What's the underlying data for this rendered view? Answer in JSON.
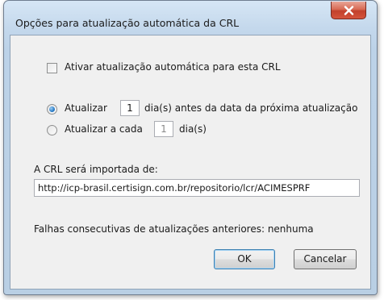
{
  "dialog": {
    "title": "Opções para atualização automática da CRL"
  },
  "auto_update": {
    "checkbox_label": "Ativar atualização automática para esta CRL",
    "checked": false
  },
  "schedule": {
    "option_before": {
      "prefix": "Atualizar",
      "value": "1",
      "suffix": "dia(s) antes da data da próxima atualização",
      "selected": true
    },
    "option_every": {
      "prefix": "Atualizar a cada",
      "value": "1",
      "suffix": "dia(s)",
      "selected": false
    }
  },
  "import": {
    "label": "A CRL será importada de:",
    "url": "http://icp-brasil.certisign.com.br/repositorio/lcr/ACIMESPRF"
  },
  "status": {
    "failures_text": "Falhas consecutivas de atualizações anteriores: nenhuma"
  },
  "buttons": {
    "ok": "OK",
    "cancel": "Cancelar"
  }
}
